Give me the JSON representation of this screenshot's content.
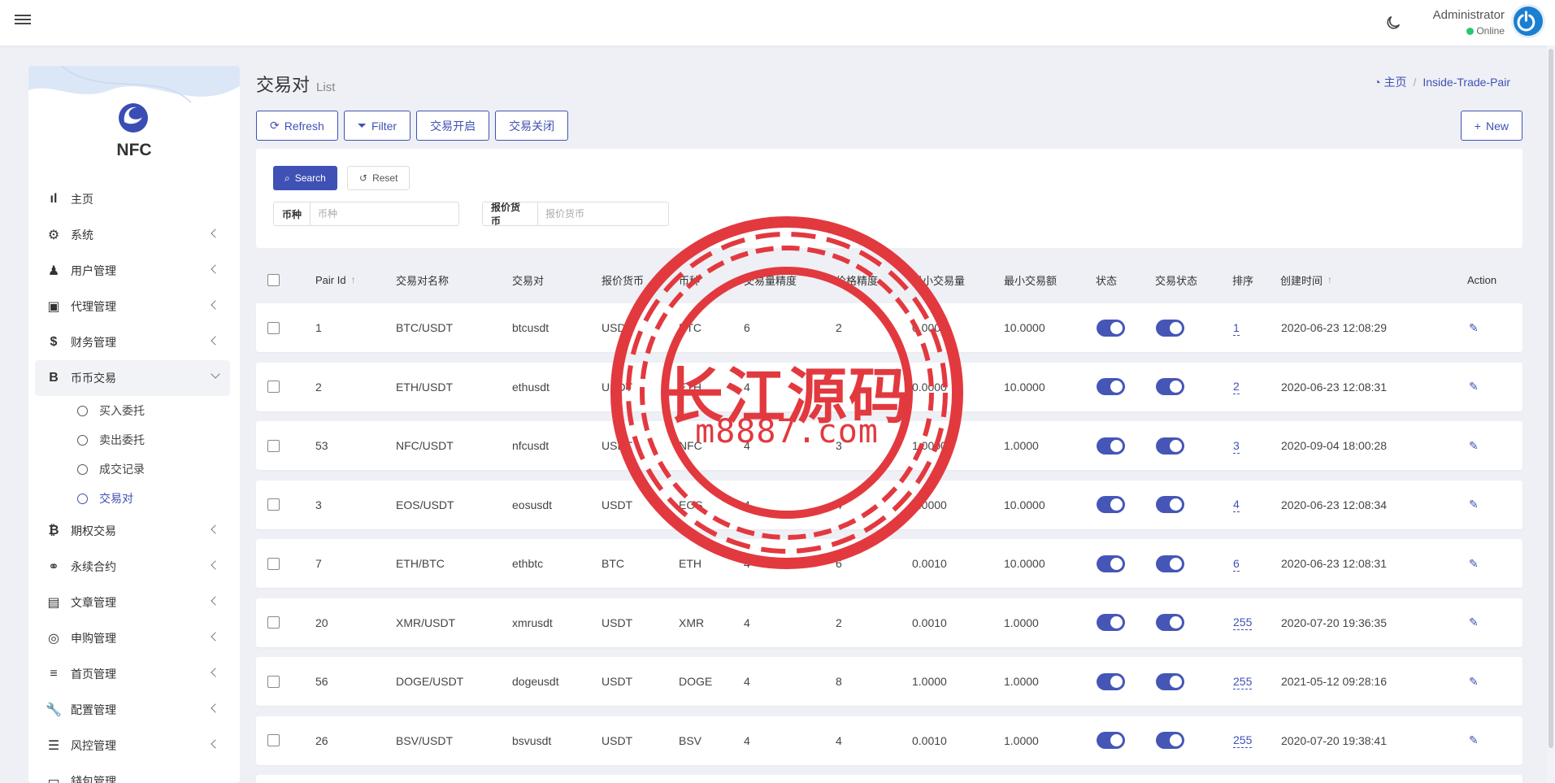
{
  "header": {
    "user_name": "Administrator",
    "user_status": "Online"
  },
  "sidebar": {
    "brand": "NFC",
    "items": [
      {
        "label": "主页",
        "icon": "bar-chart-icon",
        "glyph": "ıl",
        "has_children": false
      },
      {
        "label": "系统",
        "icon": "gear-icon",
        "glyph": "⚙",
        "has_children": true
      },
      {
        "label": "用户管理",
        "icon": "user-icon",
        "glyph": "♟",
        "has_children": true
      },
      {
        "label": "代理管理",
        "icon": "id-card-icon",
        "glyph": "▣",
        "has_children": true
      },
      {
        "label": "财务管理",
        "icon": "dollar-icon",
        "glyph": "$",
        "has_children": true
      },
      {
        "label": "币币交易",
        "icon": "bitcoin-b-icon",
        "glyph": "B",
        "has_children": true,
        "open": true
      }
    ],
    "sub_items": [
      {
        "label": "买入委托",
        "active": false
      },
      {
        "label": "卖出委托",
        "active": false
      },
      {
        "label": "成交记录",
        "active": false
      },
      {
        "label": "交易对",
        "active": true
      }
    ],
    "items_after": [
      {
        "label": "期权交易",
        "icon": "bitcoin-icon",
        "glyph": "₿"
      },
      {
        "label": "永续合约",
        "icon": "link-icon",
        "glyph": "⚭"
      },
      {
        "label": "文章管理",
        "icon": "newspaper-icon",
        "glyph": "▤"
      },
      {
        "label": "申购管理",
        "icon": "lifebuoy-icon",
        "glyph": "◎"
      },
      {
        "label": "首页管理",
        "icon": "list-icon",
        "glyph": "≡"
      },
      {
        "label": "配置管理",
        "icon": "wrench-icon",
        "glyph": "🔧"
      },
      {
        "label": "风控管理",
        "icon": "list-ul-icon",
        "glyph": "☰"
      },
      {
        "label": "錢包管理",
        "icon": "wallet-icon",
        "glyph": "▭"
      }
    ]
  },
  "page": {
    "title": "交易对",
    "subtitle": "List"
  },
  "breadcrumb": {
    "home": "主页",
    "current": "Inside-Trade-Pair"
  },
  "toolbar": {
    "refresh": "Refresh",
    "filter": "Filter",
    "open_trade": "交易开启",
    "close_trade": "交易关闭",
    "new": "New"
  },
  "filter": {
    "search": "Search",
    "reset": "Reset",
    "coin_label": "币种",
    "coin_placeholder": "币种",
    "quote_label": "报价货币",
    "quote_placeholder": "报价货币"
  },
  "table": {
    "columns": [
      "Pair Id",
      "交易对名称",
      "交易对",
      "报价货币",
      "币种",
      "交易量精度",
      "价格精度",
      "最小交易量",
      "最小交易额",
      "状态",
      "交易状态",
      "排序",
      "创建时间",
      "Action"
    ],
    "rows": [
      {
        "id": "1",
        "name": "BTC/USDT",
        "pair": "btcusdt",
        "quote": "USDT",
        "coin": "BTC",
        "amount_precision": "6",
        "price_precision": "2",
        "min_amount": "0.0000",
        "min_total": "10.0000",
        "sort": "1",
        "created": "2020-06-23 12:08:29"
      },
      {
        "id": "2",
        "name": "ETH/USDT",
        "pair": "ethusdt",
        "quote": "USDT",
        "coin": "ETH",
        "amount_precision": "4",
        "price_precision": "2",
        "min_amount": "0.0000",
        "min_total": "10.0000",
        "sort": "2",
        "created": "2020-06-23 12:08:31"
      },
      {
        "id": "53",
        "name": "NFC/USDT",
        "pair": "nfcusdt",
        "quote": "USDT",
        "coin": "NFC",
        "amount_precision": "4",
        "price_precision": "3",
        "min_amount": "1.0000",
        "min_total": "1.0000",
        "sort": "3",
        "created": "2020-09-04 18:00:28"
      },
      {
        "id": "3",
        "name": "EOS/USDT",
        "pair": "eosusdt",
        "quote": "USDT",
        "coin": "EOS",
        "amount_precision": "4",
        "price_precision": "4",
        "min_amount": "0.0000",
        "min_total": "10.0000",
        "sort": "4",
        "created": "2020-06-23 12:08:34"
      },
      {
        "id": "7",
        "name": "ETH/BTC",
        "pair": "ethbtc",
        "quote": "BTC",
        "coin": "ETH",
        "amount_precision": "4",
        "price_precision": "6",
        "min_amount": "0.0010",
        "min_total": "10.0000",
        "sort": "6",
        "created": "2020-06-23 12:08:31"
      },
      {
        "id": "20",
        "name": "XMR/USDT",
        "pair": "xmrusdt",
        "quote": "USDT",
        "coin": "XMR",
        "amount_precision": "4",
        "price_precision": "2",
        "min_amount": "0.0010",
        "min_total": "1.0000",
        "sort": "255",
        "created": "2020-07-20 19:36:35"
      },
      {
        "id": "56",
        "name": "DOGE/USDT",
        "pair": "dogeusdt",
        "quote": "USDT",
        "coin": "DOGE",
        "amount_precision": "4",
        "price_precision": "8",
        "min_amount": "1.0000",
        "min_total": "1.0000",
        "sort": "255",
        "created": "2021-05-12 09:28:16"
      },
      {
        "id": "26",
        "name": "BSV/USDT",
        "pair": "bsvusdt",
        "quote": "USDT",
        "coin": "BSV",
        "amount_precision": "4",
        "price_precision": "4",
        "min_amount": "0.0010",
        "min_total": "1.0000",
        "sort": "255",
        "created": "2020-07-20 19:38:41"
      }
    ]
  },
  "watermark": {
    "line1": "长江源码",
    "line2": "m8887.com"
  },
  "colors": {
    "accent": "#3f51b5",
    "toggle_on": "#4556b6",
    "online": "#28c76f",
    "watermark": "#e2393f"
  }
}
